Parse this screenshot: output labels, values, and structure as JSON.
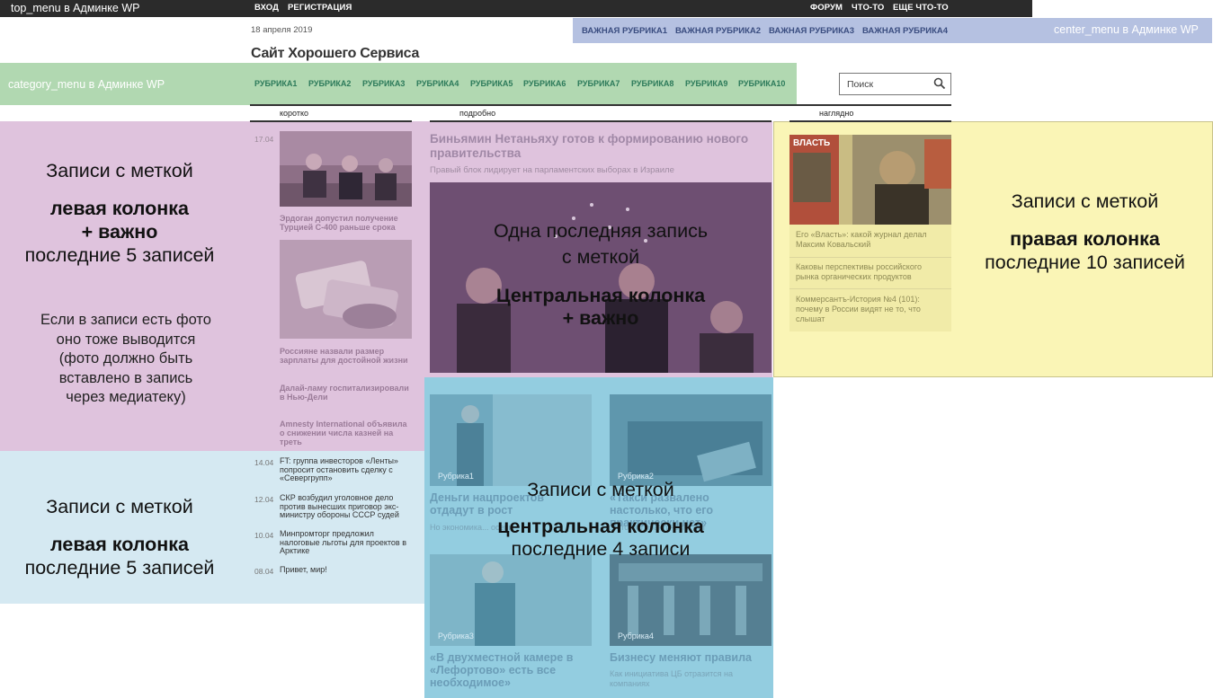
{
  "top_bar": {
    "note": "top_menu в Админке WP",
    "links": [
      "ВХОД",
      "РЕГИСТРАЦИЯ"
    ],
    "right_links": [
      "ФОРУМ",
      "ЧТО-ТО",
      "ЕЩЕ ЧТО-ТО"
    ]
  },
  "date": "18 апреля 2019",
  "site_title": "Сайт Хорошего Сервиса",
  "center_menu": {
    "items": [
      "ВАЖНАЯ РУБРИКА1",
      "ВАЖНАЯ РУБРИКА2",
      "ВАЖНАЯ РУБРИКА3",
      "ВАЖНАЯ РУБРИКА4"
    ],
    "note": "center_menu в Админке WP"
  },
  "category_menu": {
    "note": "category_menu в Админке WP",
    "items": [
      "РУБРИКА1",
      "РУБРИКА2",
      "РУБРИКА3",
      "РУБРИКА4",
      "РУБРИКА5",
      "РУБРИКА6",
      "РУБРИКА7",
      "РУБРИКА8",
      "РУБРИКА9",
      "РУБРИКА10"
    ]
  },
  "search": {
    "placeholder": "Поиск"
  },
  "columns": [
    "коротко",
    "подробно",
    "наглядно"
  ],
  "annotations": {
    "left1": {
      "l1": "Записи с меткой",
      "l2": "левая колонка",
      "l3": "+ важно",
      "l4": "последние 5 записей",
      "note": [
        "Если в записи есть фото",
        "оно тоже выводится",
        "(фото должно быть",
        "вставлено в запись",
        "через медиатеку)"
      ]
    },
    "left2": {
      "l1": "Записи с меткой",
      "l2": "левая колонка",
      "l3": "последние 5 записей"
    },
    "center1": {
      "l1": "Одна последняя запись",
      "l2": "с меткой",
      "l3": "Центральная колонка",
      "l4": "+ важно"
    },
    "center2": {
      "l1": "Записи с меткой",
      "l2": "центральная колонка",
      "l3": "последние 4 записи"
    },
    "right": {
      "l1": "Записи с меткой",
      "l2": "правая колонка",
      "l3": "последние 10 записей"
    }
  },
  "left_news_important": [
    {
      "date": "17.04",
      "title": "Эрдоган допустил получение Турцией С-400 раньше срока"
    },
    {
      "title": "Россияне назвали размер зарплаты для достойной жизни"
    },
    {
      "title": "Далай-ламу госпитализировали в Нью-Дели"
    },
    {
      "title": "Amnesty International объявила о снижении числа казней на треть"
    }
  ],
  "left_news": [
    {
      "date": "14.04",
      "title": "FT: группа инвесторов «Ленты» попросит остановить сделку с «Севергрупп»"
    },
    {
      "date": "12.04",
      "title": "СКР возбудил уголовное дело против вынесших приговор экс-министру обороны СССР судей"
    },
    {
      "date": "10.04",
      "title": "Минпромторг предложил налоговые льготы для проектов в Арктике"
    },
    {
      "date": "08.04",
      "title": "Привет, мир!"
    }
  ],
  "center_main": {
    "title": "Биньямин Нетаньяху готов к формированию нового правительства",
    "subtitle": "Правый блок лидирует на парламентских выборах в Израиле"
  },
  "center_grid": [
    {
      "rubric": "Рубрика1",
      "title": "Деньги нацпроектов отдадут в рост",
      "sub": "Но экономика... осени"
    },
    {
      "rubric": "Рубрика2",
      "title": "«Такси развалено настолько, что его практически нет»",
      "sub": "...что его практически нет"
    },
    {
      "rubric": "Рубрика3",
      "title": "«В двухместной камере в «Лефортово» есть все необходимое»",
      "sub": ""
    },
    {
      "rubric": "Рубрика4",
      "title": "Бизнесу меняют правила",
      "sub": "Как инициатива ЦБ отразится на компаниях"
    }
  ],
  "right_news": [
    "Его «Власть»: какой журнал делал Максим Ковальский",
    "Каковы перспективы российского рынка органических продуктов",
    "Коммерсантъ-История №4 (101): почему в России видят не то, что слышат"
  ],
  "right_photo_label": "ВЛАСТЬ"
}
